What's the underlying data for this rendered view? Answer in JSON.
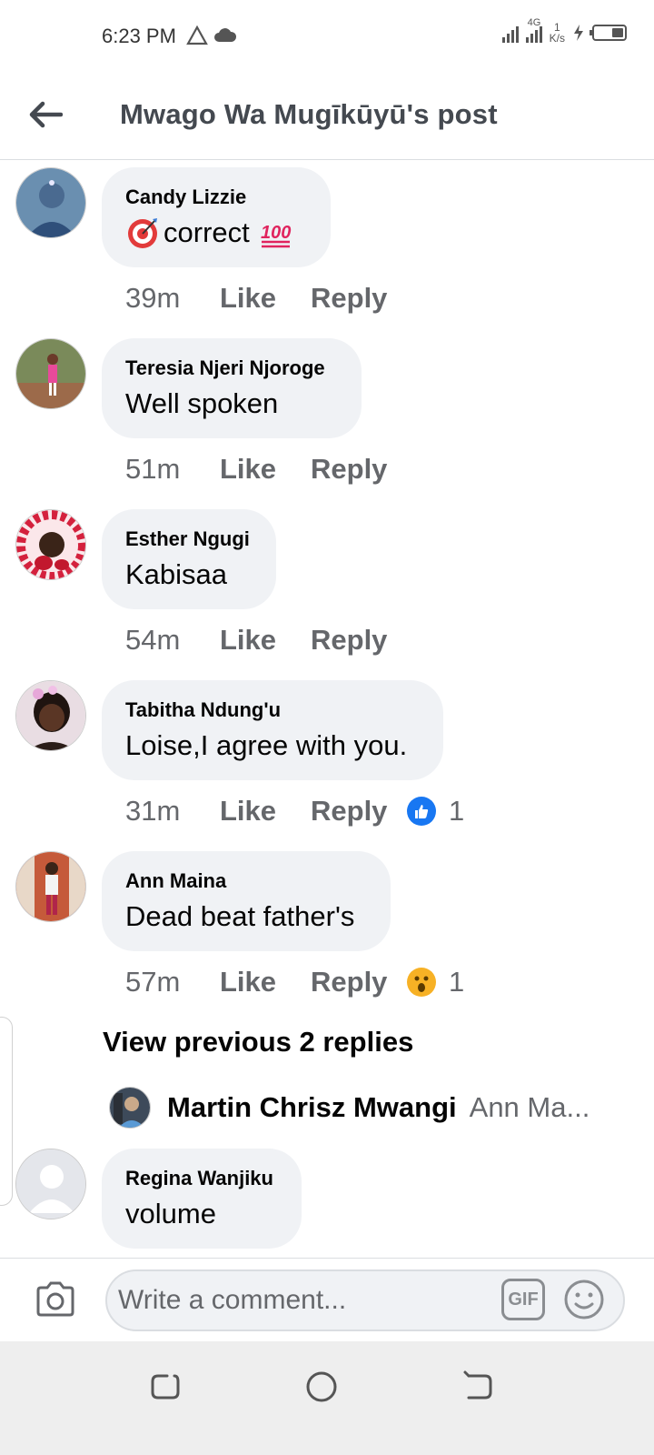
{
  "status_bar": {
    "time": "6:23 PM",
    "network_type": "4G",
    "speed_value": "1",
    "speed_unit": "K/s"
  },
  "header": {
    "title": "Mwago Wa Mugīkūyū's post"
  },
  "comments": [
    {
      "name": "Candy Lizzie",
      "text": "correct",
      "time": "39m",
      "like": "Like",
      "reply": "Reply"
    },
    {
      "name": "Teresia Njeri Njoroge",
      "text": "Well spoken",
      "time": "51m",
      "like": "Like",
      "reply": "Reply"
    },
    {
      "name": "Esther Ngugi",
      "text": "Kabisaa",
      "time": "54m",
      "like": "Like",
      "reply": "Reply"
    },
    {
      "name": "Tabitha Ndung'u",
      "text": "Loise,I agree with you.",
      "time": "31m",
      "like": "Like",
      "reply": "Reply",
      "reaction_count": "1",
      "reaction_icon": "thumbs-up-icon"
    },
    {
      "name": "Ann Maina",
      "text": "Dead beat father's",
      "time": "57m",
      "like": "Like",
      "reply": "Reply",
      "reaction_count": "1",
      "reaction_icon": "wow-icon"
    },
    {
      "name": "Regina Wanjiku",
      "text": "volume"
    }
  ],
  "replies": {
    "view_previous": "View previous 2 replies",
    "preview_name": "Martin Chrisz Mwangi",
    "preview_text": "Ann Ma..."
  },
  "composer": {
    "placeholder": "Write a comment...",
    "gif_label": "GIF"
  },
  "colors": {
    "bubble_bg": "#f0f2f5",
    "meta_text": "#65676b",
    "like_blue": "#1877f2",
    "wow_yellow": "#f7b125"
  }
}
